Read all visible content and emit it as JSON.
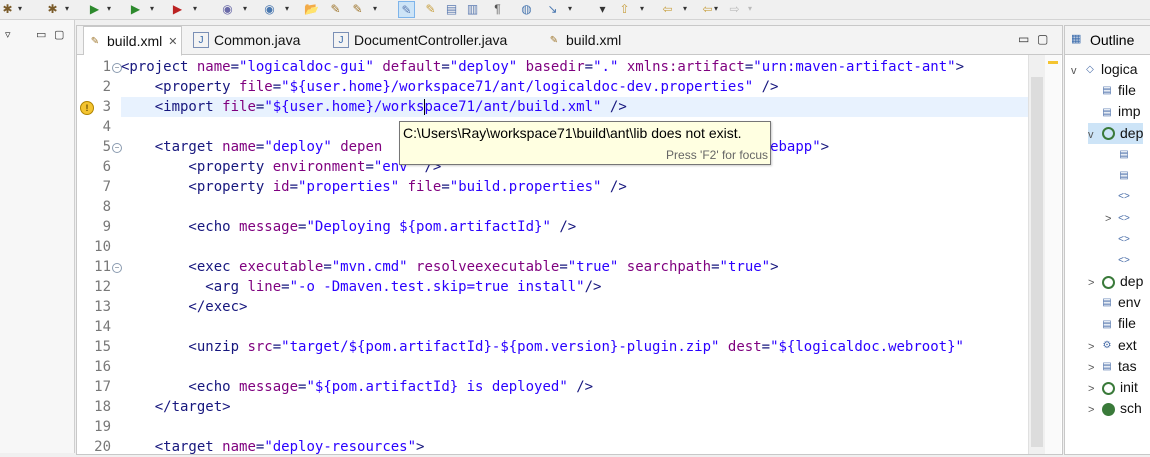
{
  "toolbar": {
    "icons": [
      "debug-icon",
      "run-icon",
      "coverage-icon",
      "external-tools-icon",
      "new-java-class-icon",
      "new-package-icon",
      "open-folder-icon",
      "build-icon",
      "toggle-mark-occurrences-icon",
      "pen-icon",
      "editor-icon",
      "block-selection-icon",
      "whitespace-icon",
      "globe-icon",
      "next-annotation-icon",
      "prev-annotation-icon",
      "last-edit-icon",
      "back-icon",
      "forward-icon"
    ],
    "glyphs": {
      "debug": "✱",
      "run": "▶",
      "coverage": "▶",
      "external": "▶",
      "new_class": "◉",
      "new_pkg": "◉",
      "folder": "📂",
      "build": "✎",
      "mark": "✎",
      "pen": "✎",
      "edit": "▤",
      "block": "▥",
      "ws": "¶",
      "globe": "◍",
      "next": "↘",
      "up": "⇧",
      "back": "⇦",
      "fwd": "⇨",
      "dd": "▾"
    }
  },
  "left_panel": {
    "minimize": "▭",
    "maximize": "▢",
    "menu_glyph": "▿"
  },
  "editor": {
    "tabs": [
      {
        "label": "build.xml",
        "close": "✕",
        "icon": "✎"
      },
      {
        "label": "Common.java",
        "icon": "J"
      },
      {
        "label": "DocumentController.java",
        "icon": "J"
      },
      {
        "label": "build.xml",
        "icon": "✎"
      }
    ],
    "window_controls": {
      "minimize": "▭",
      "maximize": "▢"
    },
    "line_numbers": [
      "1",
      "2",
      "3",
      "4",
      "5",
      "6",
      "7",
      "8",
      "9",
      "10",
      "11",
      "12",
      "13",
      "14",
      "15",
      "16",
      "17",
      "18",
      "19",
      "20"
    ],
    "fold_marker": "−",
    "warning_marker": "!",
    "lines": [
      [
        [
          "tag",
          "<project "
        ],
        [
          "attr",
          "name"
        ],
        [
          "tag",
          "="
        ],
        [
          "val",
          "\"logicaldoc-gui\""
        ],
        [
          "tag",
          " "
        ],
        [
          "attr",
          "default"
        ],
        [
          "tag",
          "="
        ],
        [
          "val",
          "\"deploy\""
        ],
        [
          "tag",
          " "
        ],
        [
          "attr",
          "basedir"
        ],
        [
          "tag",
          "="
        ],
        [
          "val",
          "\".\""
        ],
        [
          "tag",
          " "
        ],
        [
          "attr",
          "xmlns:artifact"
        ],
        [
          "tag",
          "="
        ],
        [
          "val",
          "\"urn:maven-artifact-ant\""
        ],
        [
          "tag",
          ">"
        ]
      ],
      [
        [
          "tag",
          "    <property "
        ],
        [
          "attr",
          "file"
        ],
        [
          "tag",
          "="
        ],
        [
          "val",
          "\"${user.home}/workspace71/ant/logicaldoc-dev.properties\""
        ],
        [
          "tag",
          " />"
        ]
      ],
      [
        [
          "tag",
          "    <import "
        ],
        [
          "attr",
          "file"
        ],
        [
          "tag",
          "="
        ],
        [
          "val",
          "\"${user.home}/works"
        ],
        [
          "caret",
          ""
        ],
        [
          "val",
          "pace71/ant/build.xml\""
        ],
        [
          "tag",
          " />"
        ]
      ],
      [],
      [
        [
          "tag",
          "    <target "
        ],
        [
          "attr",
          "name"
        ],
        [
          "tag",
          "="
        ],
        [
          "val",
          "\"deploy\""
        ],
        [
          "tag",
          " "
        ],
        [
          "attr",
          "depen"
        ],
        [
          "tag",
          "                                        "
        ],
        [
          "val",
          "oyed webapp\""
        ],
        [
          "tag",
          ">"
        ]
      ],
      [
        [
          "tag",
          "        <property "
        ],
        [
          "attr",
          "environment"
        ],
        [
          "tag",
          "="
        ],
        [
          "val",
          "\"env\""
        ],
        [
          "tag",
          " />"
        ]
      ],
      [
        [
          "tag",
          "        <property "
        ],
        [
          "attr",
          "id"
        ],
        [
          "tag",
          "="
        ],
        [
          "val",
          "\"properties\""
        ],
        [
          "tag",
          " "
        ],
        [
          "attr",
          "file"
        ],
        [
          "tag",
          "="
        ],
        [
          "val",
          "\"build.properties\""
        ],
        [
          "tag",
          " />"
        ]
      ],
      [],
      [
        [
          "tag",
          "        <echo "
        ],
        [
          "attr",
          "message"
        ],
        [
          "tag",
          "="
        ],
        [
          "val",
          "\"Deploying ${pom.artifactId}\""
        ],
        [
          "tag",
          " />"
        ]
      ],
      [],
      [
        [
          "tag",
          "        <exec "
        ],
        [
          "attr",
          "executable"
        ],
        [
          "tag",
          "="
        ],
        [
          "val",
          "\"mvn.cmd\""
        ],
        [
          "tag",
          " "
        ],
        [
          "attr",
          "resolveexecutable"
        ],
        [
          "tag",
          "="
        ],
        [
          "val",
          "\"true\""
        ],
        [
          "tag",
          " "
        ],
        [
          "attr",
          "searchpath"
        ],
        [
          "tag",
          "="
        ],
        [
          "val",
          "\"true\""
        ],
        [
          "tag",
          ">"
        ]
      ],
      [
        [
          "tag",
          "          <arg "
        ],
        [
          "attr",
          "line"
        ],
        [
          "tag",
          "="
        ],
        [
          "val",
          "\"-o -Dmaven.test.skip=true install\""
        ],
        [
          "tag",
          "/>"
        ]
      ],
      [
        [
          "tag",
          "        </exec>"
        ]
      ],
      [],
      [
        [
          "tag",
          "        <unzip "
        ],
        [
          "attr",
          "src"
        ],
        [
          "tag",
          "="
        ],
        [
          "val",
          "\"target/${pom.artifactId}-${pom.version}-plugin.zip\""
        ],
        [
          "tag",
          " "
        ],
        [
          "attr",
          "dest"
        ],
        [
          "tag",
          "="
        ],
        [
          "val",
          "\"${logicaldoc.webroot}\""
        ]
      ],
      [],
      [
        [
          "tag",
          "        <echo "
        ],
        [
          "attr",
          "message"
        ],
        [
          "tag",
          "="
        ],
        [
          "val",
          "\"${pom.artifactId} is deployed\""
        ],
        [
          "tag",
          " />"
        ]
      ],
      [
        [
          "tag",
          "    </target>"
        ]
      ],
      [],
      [
        [
          "tag",
          "    <target "
        ],
        [
          "attr",
          "name"
        ],
        [
          "tag",
          "="
        ],
        [
          "val",
          "\"deploy-resources\""
        ],
        [
          "tag",
          ">"
        ]
      ]
    ],
    "tooltip": {
      "message": "C:\\Users\\Ray\\workspace71\\build\\ant\\lib does not exist.",
      "hint": "Press 'F2' for focus"
    }
  },
  "outline": {
    "title": "Outline",
    "rows": [
      {
        "label": "logica",
        "arrow": "v",
        "icon": "◇",
        "level": 0
      },
      {
        "label": "file",
        "arrow": "",
        "icon": "▤",
        "level": 1
      },
      {
        "label": "imp",
        "arrow": "",
        "icon": "▤",
        "level": 1
      },
      {
        "label": "dep",
        "arrow": "v",
        "icon": "◎",
        "level": 1
      },
      {
        "label": "",
        "arrow": "",
        "icon": "▤",
        "level": 2
      },
      {
        "label": "",
        "arrow": "",
        "icon": "▤",
        "level": 2
      },
      {
        "label": "",
        "arrow": "",
        "icon": "<>",
        "level": 2
      },
      {
        "label": "",
        "arrow": ">",
        "icon": "<>",
        "level": 2
      },
      {
        "label": "",
        "arrow": "",
        "icon": "<>",
        "level": 2
      },
      {
        "label": "",
        "arrow": "",
        "icon": "<>",
        "level": 2
      },
      {
        "label": "dep",
        "arrow": ">",
        "icon": "◎",
        "level": 1
      },
      {
        "label": "env",
        "arrow": "",
        "icon": "▤",
        "level": 1
      },
      {
        "label": "file",
        "arrow": "",
        "icon": "▤",
        "level": 1
      },
      {
        "label": "ext",
        "arrow": ">",
        "icon": "⚙",
        "level": 1
      },
      {
        "label": "tas",
        "arrow": ">",
        "icon": "▤",
        "level": 1
      },
      {
        "label": "init",
        "arrow": ">",
        "icon": "◎",
        "level": 1
      },
      {
        "label": "sch",
        "arrow": ">",
        "icon": "●",
        "level": 1
      }
    ]
  }
}
